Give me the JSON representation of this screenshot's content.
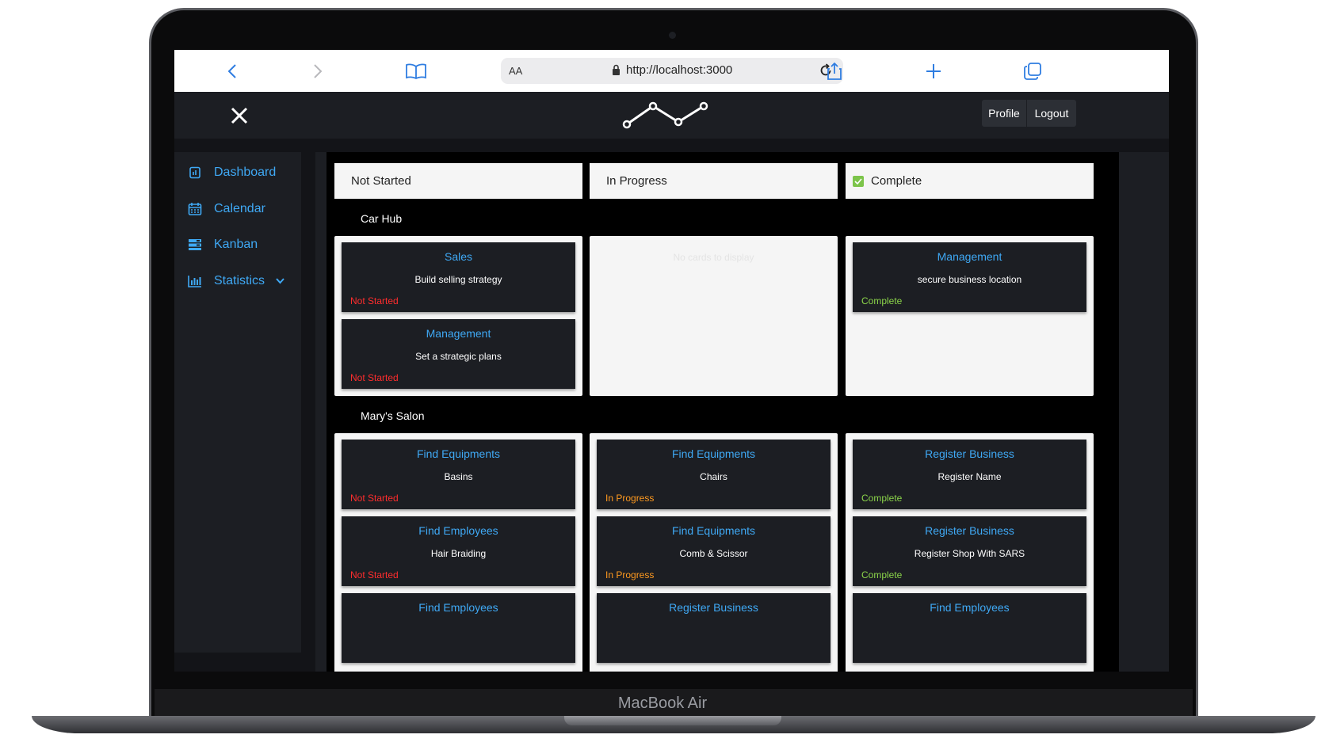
{
  "device": {
    "brand_label": "MacBook Air"
  },
  "browser": {
    "text_size_label": "AA",
    "url": "http://localhost:3000",
    "icons": [
      "back-icon",
      "forward-icon",
      "bookmarks-icon",
      "lock-icon",
      "reload-icon",
      "share-icon",
      "new-tab-icon",
      "tabs-icon"
    ]
  },
  "header": {
    "profile_label": "Profile",
    "logout_label": "Logout",
    "icons": [
      "close-icon",
      "logo-icon"
    ]
  },
  "sidebar": {
    "items": [
      {
        "label": "Dashboard",
        "icon": "dashboard-icon"
      },
      {
        "label": "Calendar",
        "icon": "calendar-icon"
      },
      {
        "label": "Kanban",
        "icon": "kanban-icon"
      },
      {
        "label": "Statistics",
        "icon": "bar-chart-icon"
      }
    ]
  },
  "kanban": {
    "columns": [
      {
        "label": "Not Started"
      },
      {
        "label": "In Progress"
      },
      {
        "label": "Complete"
      }
    ],
    "empty_text": "No cards to display",
    "colors": {
      "not_started": "#ff2d2d",
      "in_progress": "#ff9a1f",
      "complete": "#8bd44a",
      "accent": "#3fa9f5"
    },
    "groups": [
      {
        "title": "Car Hub",
        "not_started": [
          {
            "title": "Sales",
            "desc": "Build selling strategy",
            "status": "Not Started"
          },
          {
            "title": "Management",
            "desc": "Set a strategic plans",
            "status": "Not Started"
          }
        ],
        "in_progress": [],
        "complete": [
          {
            "title": "Management",
            "desc": "secure business location",
            "status": "Complete"
          }
        ]
      },
      {
        "title": "Mary's Salon",
        "not_started": [
          {
            "title": "Find Equipments",
            "desc": "Basins",
            "status": "Not Started"
          },
          {
            "title": "Find Employees",
            "desc": "Hair Braiding",
            "status": "Not Started"
          },
          {
            "title": "Find Employees",
            "desc": "",
            "status": ""
          }
        ],
        "in_progress": [
          {
            "title": "Find Equipments",
            "desc": "Chairs",
            "status": "In Progress"
          },
          {
            "title": "Find Equipments",
            "desc": "Comb & Scissor",
            "status": "In Progress"
          },
          {
            "title": "Register Business",
            "desc": "",
            "status": ""
          }
        ],
        "complete": [
          {
            "title": "Register Business",
            "desc": "Register Name",
            "status": "Complete"
          },
          {
            "title": "Register Business",
            "desc": "Register Shop With SARS",
            "status": "Complete"
          },
          {
            "title": "Find Employees",
            "desc": "",
            "status": ""
          }
        ]
      }
    ]
  }
}
